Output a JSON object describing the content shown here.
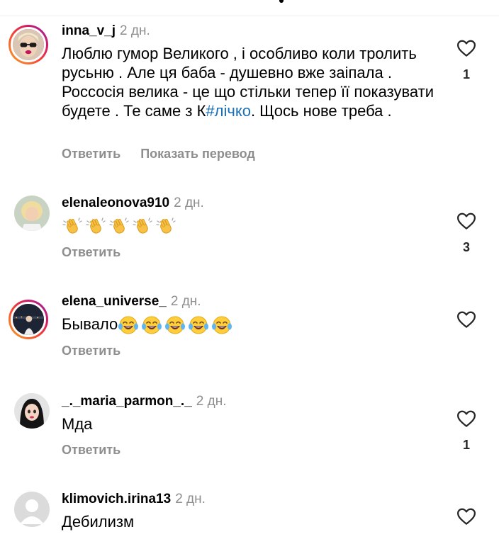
{
  "comments": [
    {
      "username": "inna_v_j",
      "time": "2 дн.",
      "text_before": "Люблю гумор Великого , і особливо коли тролить русьню . Але ця баба - душевно вже заіпала . Россосія велика - це що стільки тепер її показувати будете . Те саме з К",
      "hashtag": "#лічко",
      "text_after": ".  Щось нове треба .",
      "reply_label": "Ответить",
      "translate_label": "Показать перевод",
      "like_count": "1",
      "avatar_icon": "woman-sunglasses-avatar"
    },
    {
      "username": "elenaleonova910",
      "time": "2 дн.",
      "emoji": "clapping-hands-icon",
      "emoji_count": 5,
      "reply_label": "Ответить",
      "like_count": "3",
      "avatar_icon": "woman-blonde-avatar"
    },
    {
      "username": "elena_universe_",
      "time": "2 дн.",
      "text": "Бывало",
      "emoji": "tears-of-joy-icon",
      "emoji_count": 5,
      "reply_label": "Ответить",
      "like_count": "",
      "avatar_icon": "night-city-avatar"
    },
    {
      "username": "_._maria_parmon_._",
      "time": "2 дн.",
      "text": "Мда",
      "reply_label": "Ответить",
      "like_count": "1",
      "avatar_icon": "cartoon-girl-avatar"
    },
    {
      "username": "klimovich.irina13",
      "time": "2 дн.",
      "text": "Дебилизм",
      "reply_label": "",
      "like_count": "",
      "avatar_icon": "default-user-avatar"
    }
  ],
  "colors": {
    "username": "#000000",
    "secondary_text": "#8e8e8e",
    "hashtag": "#1a6fb8",
    "story_ring": "#d81b60"
  },
  "icons": {
    "like": "heart-outline-icon"
  }
}
